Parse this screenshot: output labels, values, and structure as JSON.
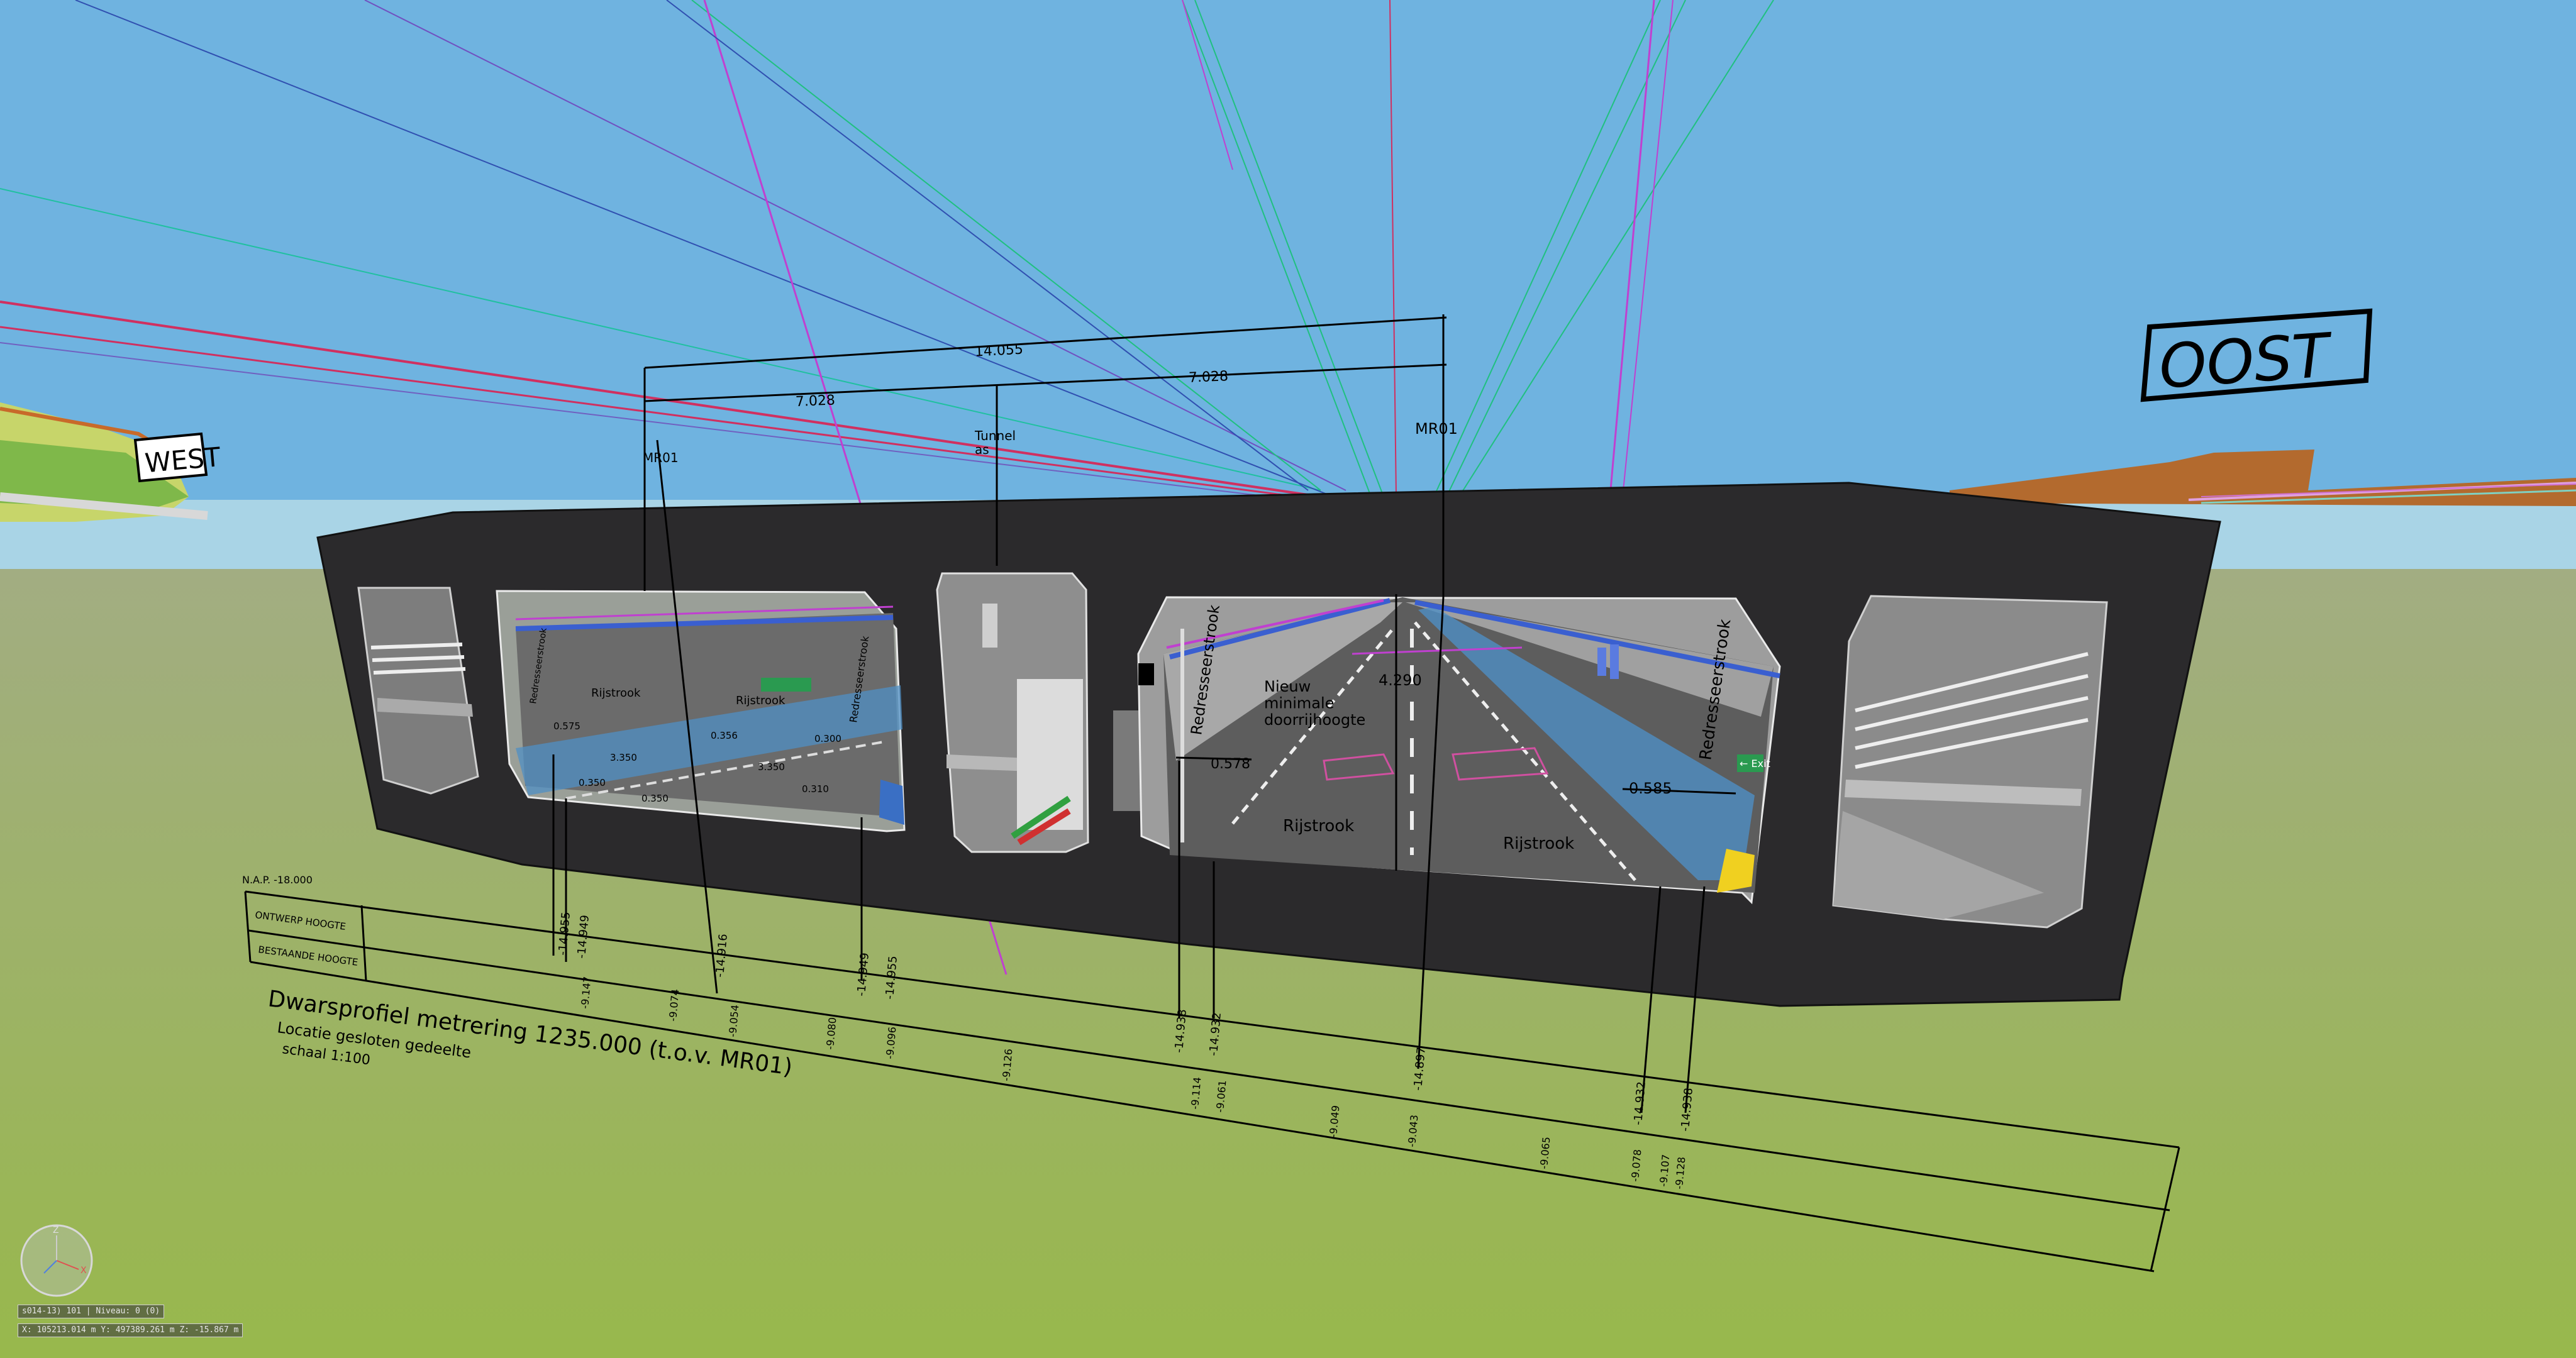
{
  "compass": {
    "west": "WEST",
    "east": "OOST"
  },
  "dimensions": {
    "total": "14.055",
    "left": "7.028",
    "right": "7.028",
    "clearance": "4.290",
    "left_offset": "0.578",
    "right_offset": "0.585"
  },
  "reference_lines": {
    "mr01_left": "MR01",
    "tunnel_axis": "Tunnel\nas",
    "mr01_right": "MR01"
  },
  "tunnel_labels": {
    "redresseerstrook": "Redresseerstrook",
    "rijstrook": "Rijstrook",
    "new_min_height": "Nieuw\nminimale\ndoorrijhoogte"
  },
  "left_bore_dims": [
    "0.575",
    "0.356",
    "3.350",
    "0.300",
    "0.350",
    "3.350",
    "0.350",
    "0.310"
  ],
  "profile_table": {
    "nap": "N.A.P. -18.000",
    "row_design": "ONTWERP HOOGTE",
    "row_existing": "BESTAANDE HOOGTE",
    "design_values": [
      "-14.955",
      "-14.949",
      "-14.916",
      "-14.949",
      "-14.955",
      "-14.938",
      "-14.932",
      "-14.897",
      "-14.932",
      "-14.938"
    ],
    "existing_values": [
      "-9.147",
      "-9.074",
      "-9.054",
      "-9.080",
      "-9.096",
      "-9.126",
      "-9.114",
      "-9.061",
      "-9.049",
      "-9.043",
      "-9.065",
      "-9.078",
      "-9.107",
      "-9.128"
    ]
  },
  "title_block": {
    "title": "Dwarsprofiel metrering 1235.000 (t.o.v. MR01)",
    "subtitle": "Locatie gesloten gedeelte",
    "scale": "schaal 1:100"
  },
  "signs": {
    "exit": "← Exit"
  },
  "hud": {
    "axis_z": "Z",
    "axis_x": "X",
    "status_line1": "s014-13) 101 | Niveau: 0 (0)",
    "status_line2": "X: 105213.014 m  Y: 497389.261 m  Z: -15.867 m"
  },
  "colors": {
    "sky": "#6fb3e0",
    "ground_far": "#9fb07a",
    "ground_near": "#9ab84f",
    "tunnel_body": "#2b2a2c",
    "road_blue": "#4f8fc4",
    "wall_gray": "#8a8a8a",
    "magenta": "#c040d0",
    "green_line": "#20c080"
  }
}
